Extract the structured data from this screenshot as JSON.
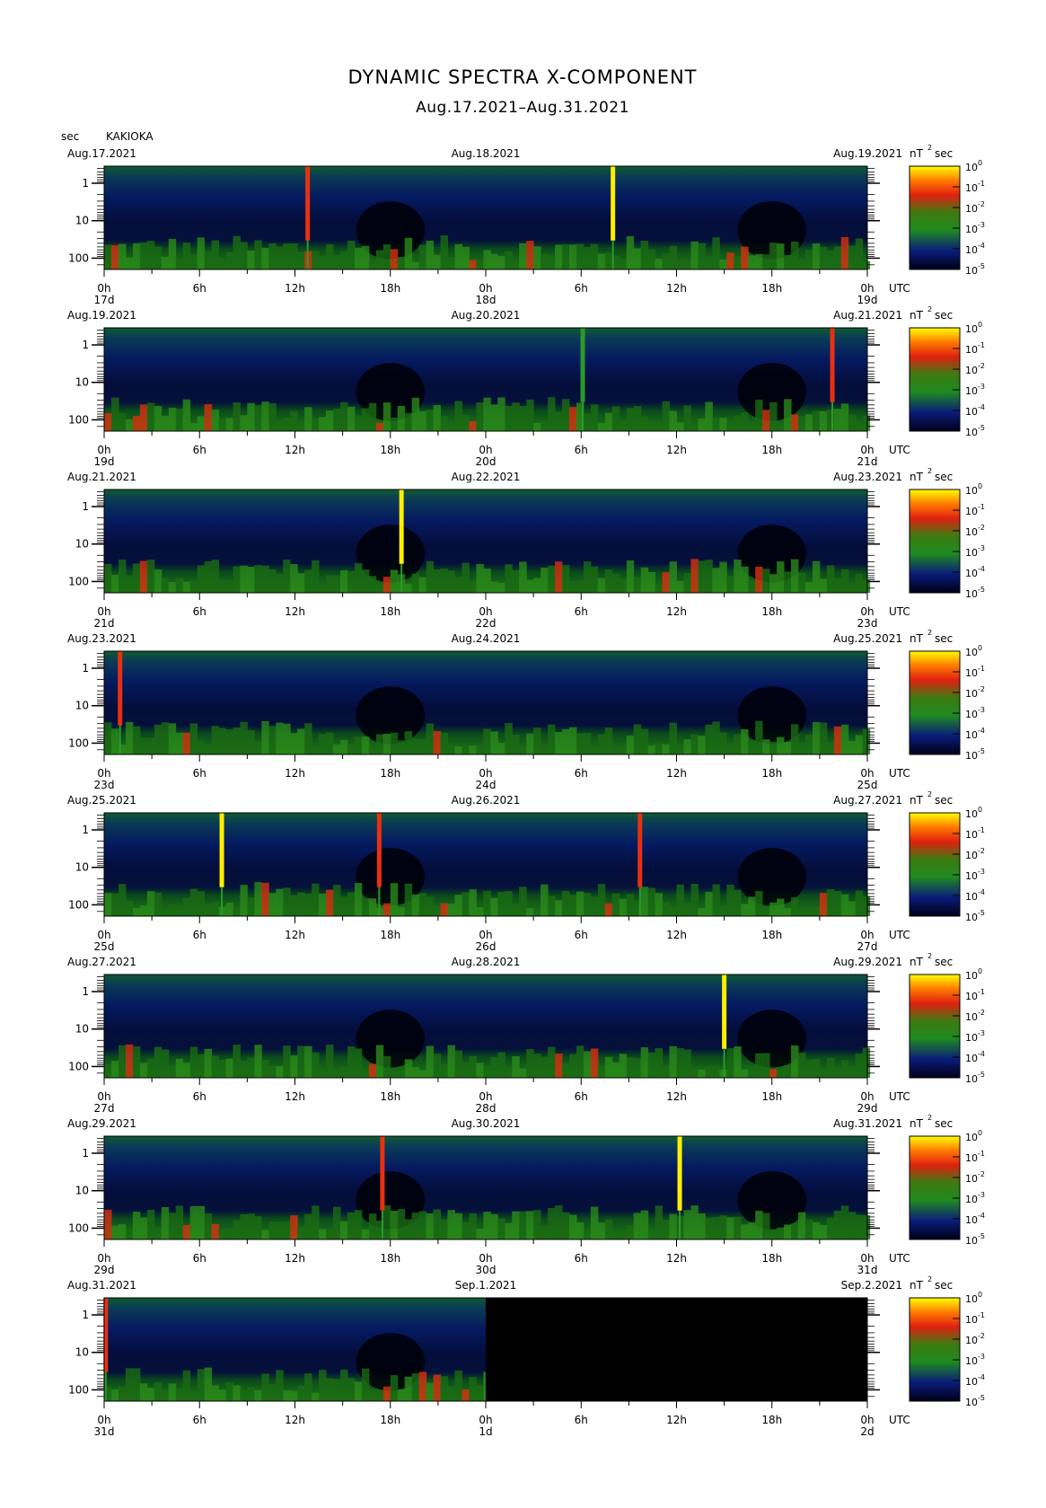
{
  "title": "DYNAMIC SPECTRA X-COMPONENT",
  "subtitle": "Aug.17.2021–Aug.31.2021",
  "station": "KAKIOKA",
  "y_unit": "sec",
  "units_label": "nT",
  "units_exp": "2",
  "units_suffix": "sec",
  "utc_label": "UTC",
  "colors": {
    "background": "#00004a",
    "low": "#001a6e",
    "mid": "#1c7a1c",
    "high": "#e0301a",
    "peak": "#ffe400",
    "frame": "#000000"
  },
  "chart_data": {
    "type": "heatmap",
    "title": "DYNAMIC SPECTRA X-COMPONENT",
    "subtitle": "Aug.17.2021–Aug.31.2021",
    "ylabel": "sec",
    "y_ticks": [
      "1",
      "10",
      "100"
    ],
    "y_scale": "log",
    "x_ticks": [
      "0h",
      "6h",
      "12h",
      "18h",
      "0h",
      "6h",
      "12h",
      "18h",
      "0h"
    ],
    "colorbar": {
      "label": "nT",
      "label_exp": "2",
      "label_suffix": "sec",
      "scale": "log",
      "ticks": [
        {
          "mant": "10",
          "exp": "0"
        },
        {
          "mant": "10",
          "exp": "-1"
        },
        {
          "mant": "10",
          "exp": "-2"
        },
        {
          "mant": "10",
          "exp": "-3"
        },
        {
          "mant": "10",
          "exp": "-4"
        },
        {
          "mant": "10",
          "exp": "-5"
        }
      ]
    },
    "panels": [
      {
        "left_date": "Aug.17.2021",
        "mid_date": "Aug.18.2021",
        "right_date": "Aug.19.2021",
        "day_labels": [
          "17d",
          "18d",
          "19d"
        ],
        "events": [
          {
            "hour": 12.8,
            "peak": "high"
          },
          {
            "hour": 32.0,
            "peak": "peak"
          }
        ]
      },
      {
        "left_date": "Aug.19.2021",
        "mid_date": "Aug.20.2021",
        "right_date": "Aug.21.2021",
        "day_labels": [
          "19d",
          "20d",
          "21d"
        ],
        "events": [
          {
            "hour": 30.1,
            "peak": "mid"
          },
          {
            "hour": 45.8,
            "peak": "high"
          }
        ]
      },
      {
        "left_date": "Aug.21.2021",
        "mid_date": "Aug.22.2021",
        "right_date": "Aug.23.2021",
        "day_labels": [
          "21d",
          "22d",
          "23d"
        ],
        "events": [
          {
            "hour": 18.7,
            "peak": "peak"
          }
        ]
      },
      {
        "left_date": "Aug.23.2021",
        "mid_date": "Aug.24.2021",
        "right_date": "Aug.25.2021",
        "day_labels": [
          "23d",
          "24d",
          "25d"
        ],
        "events": [
          {
            "hour": 1.0,
            "peak": "high"
          }
        ]
      },
      {
        "left_date": "Aug.25.2021",
        "mid_date": "Aug.26.2021",
        "right_date": "Aug.27.2021",
        "day_labels": [
          "25d",
          "26d",
          "27d"
        ],
        "events": [
          {
            "hour": 7.4,
            "peak": "peak"
          },
          {
            "hour": 17.3,
            "peak": "high"
          },
          {
            "hour": 33.7,
            "peak": "high"
          }
        ]
      },
      {
        "left_date": "Aug.27.2021",
        "mid_date": "Aug.28.2021",
        "right_date": "Aug.29.2021",
        "day_labels": [
          "27d",
          "28d",
          "29d"
        ],
        "events": [
          {
            "hour": 39.0,
            "peak": "peak"
          }
        ]
      },
      {
        "left_date": "Aug.29.2021",
        "mid_date": "Aug.30.2021",
        "right_date": "Aug.31.2021",
        "day_labels": [
          "29d",
          "30d",
          "31d"
        ],
        "events": [
          {
            "hour": 17.5,
            "peak": "high"
          },
          {
            "hour": 36.2,
            "peak": "peak"
          }
        ]
      },
      {
        "left_date": "Aug.31.2021",
        "mid_date": "Sep.1.2021",
        "right_date": "Sep.2.2021",
        "day_labels": [
          "31d",
          "1d",
          "2d"
        ],
        "events": [
          {
            "hour": 0.1,
            "peak": "high"
          }
        ],
        "no_data_from_hour": 24
      }
    ]
  }
}
